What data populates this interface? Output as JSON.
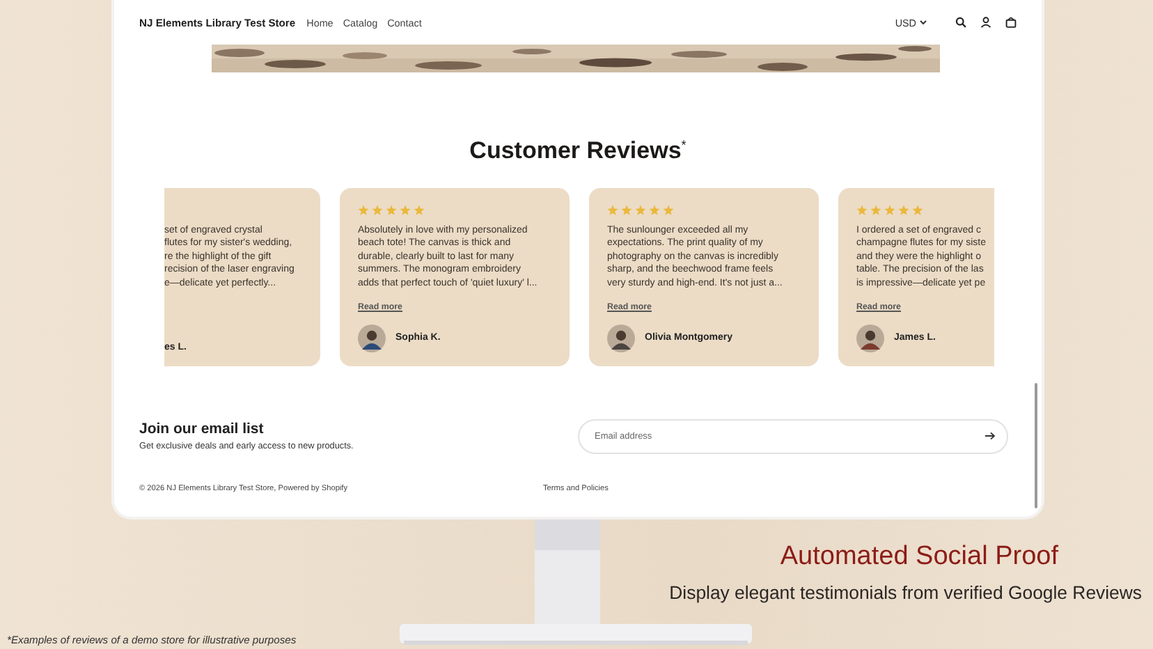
{
  "header": {
    "store_name": "NJ Elements Library Test Store",
    "nav": [
      "Home",
      "Catalog",
      "Contact"
    ],
    "currency": "USD"
  },
  "reviews": {
    "title": "Customer Reviews$^{*}$",
    "cards": [
      {
        "kind": "clipped_left",
        "lines": [
          "set of engraved crystal",
          "flutes for my sister's wedding,",
          "re the highlight of the gift",
          "recision of the laser engraving",
          "e—delicate yet perfectly..."
        ],
        "name": "es L."
      },
      {
        "kind": "full",
        "stars": 5,
        "lines": [
          "Absolutely in love with my personalized",
          "beach tote! The canvas is thick and",
          "durable, clearly built to last for many",
          "summers. The monogram embroidery",
          "adds that perfect touch of 'quiet luxury' l..."
        ],
        "read_more": "Read more",
        "name": "Sophia K."
      },
      {
        "kind": "full",
        "stars": 5,
        "lines": [
          "The sunlounger exceeded all my",
          "expectations. The print quality of my",
          "photography on the canvas is incredibly",
          "sharp, and the beechwood frame feels",
          "very sturdy and high-end. It's not just a..."
        ],
        "read_more": "Read more",
        "name": "Olivia Montgomery"
      },
      {
        "kind": "clipped_right",
        "stars": 5,
        "lines": [
          "I ordered a set of engraved c",
          "champagne flutes for my siste",
          "and they were the highlight o",
          "table. The precision of the las",
          "is impressive—delicate yet pe"
        ],
        "read_more": "Read more",
        "name": "James L."
      }
    ]
  },
  "newsletter": {
    "title": "Join our email list",
    "subtitle": "Get exclusive deals and early access to new products.",
    "email": {
      "placeholder": "Email address"
    }
  },
  "footer": {
    "copyright": "© 2026 NJ Elements Library Test Store, Powered by Shopify",
    "links": [
      "Terms and Policies"
    ]
  },
  "promo": {
    "title": "Automated Social Proof",
    "subtitle": "Display elegant testimonials from verified Google Reviews",
    "footnote": "*Examples of reviews of a demo store for illustrative purposes"
  }
}
